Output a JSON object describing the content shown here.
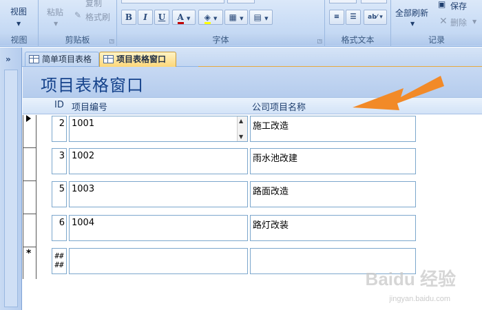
{
  "ribbon": {
    "view": {
      "button": "视图",
      "group": "视图"
    },
    "clipboard": {
      "paste": "粘贴",
      "copy": "复制",
      "format_painter": "格式刷",
      "group": "剪贴板"
    },
    "font": {
      "group": "字体",
      "bold": "B",
      "italic": "I",
      "underline": "U",
      "font_color": "A"
    },
    "rich_text": {
      "group": "格式文本"
    },
    "records": {
      "refresh_all": "全部刷新",
      "save": "保存",
      "delete": "删除",
      "group": "记录"
    }
  },
  "nav": {
    "collapse": "»"
  },
  "tabs": [
    {
      "label": "简单项目表格",
      "active": false
    },
    {
      "label": "项目表格窗口",
      "active": true
    }
  ],
  "form": {
    "title": "项目表格窗口",
    "headers": {
      "id": "ID",
      "code": "项目编号",
      "name": "公司项目名称"
    },
    "rows": [
      {
        "id": "2",
        "code": "1001",
        "name": "施工改造",
        "current": true
      },
      {
        "id": "3",
        "code": "1002",
        "name": "雨水池改建",
        "current": false
      },
      {
        "id": "5",
        "code": "1003",
        "name": "路面改造",
        "current": false
      },
      {
        "id": "6",
        "code": "1004",
        "name": "路灯改装",
        "current": false
      }
    ],
    "new_row": {
      "marker": "*",
      "id_line1": "##",
      "id_line2": "##"
    }
  },
  "watermark": {
    "brand": "Baidu 经验",
    "url": "jingyan.baidu.com"
  },
  "colors": {
    "accent_arrow": "#f08020",
    "active_tab": "#fdd77a",
    "ribbon": "#c9dcf5"
  }
}
